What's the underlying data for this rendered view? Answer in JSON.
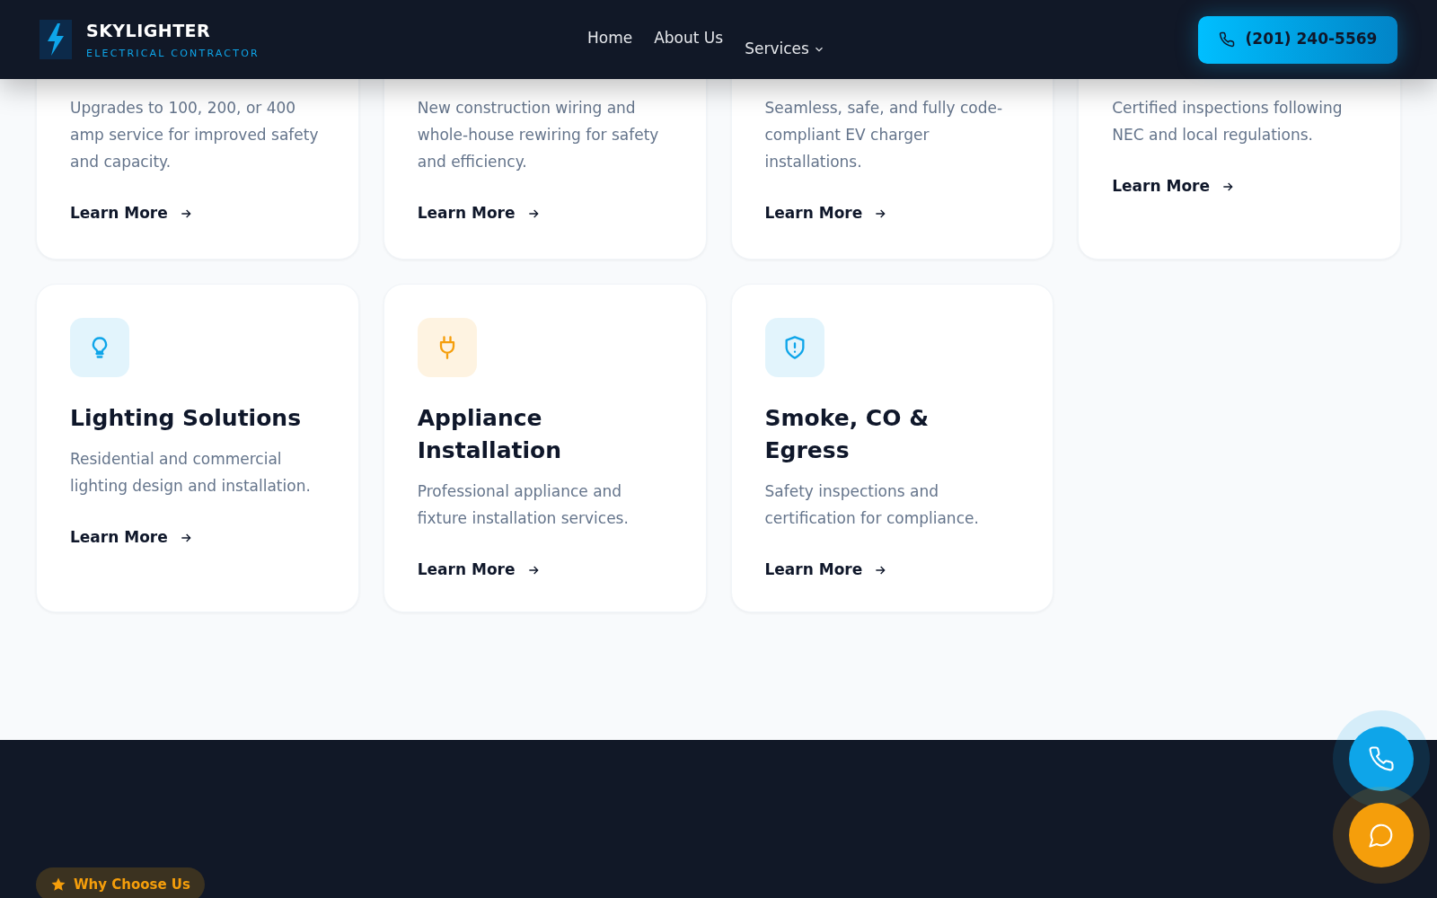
{
  "header": {
    "brand": "SKYLIGHTER",
    "tagline": "ELECTRICAL CONTRACTOR",
    "nav": [
      {
        "label": "Home",
        "dropdown": false
      },
      {
        "label": "About Us",
        "dropdown": false
      },
      {
        "label": "Services",
        "dropdown": true
      }
    ],
    "phone": "(201) 240-5569"
  },
  "services_top": [
    {
      "description": "Upgrades to 100, 200, or 400 amp service for improved safety and capacity.",
      "link": "Learn More"
    },
    {
      "description": "New construction wiring and whole-house rewiring for safety and efficiency.",
      "link": "Learn More"
    },
    {
      "description": "Seamless, safe, and fully code-compliant EV charger installations.",
      "link": "Learn More"
    },
    {
      "description": "Certified inspections following NEC and local regulations.",
      "link": "Learn More"
    }
  ],
  "services": [
    {
      "kind": "bulb",
      "color": "#0ea5e9",
      "title": "Lighting Solutions",
      "description": "Residential and commercial lighting design and installation.",
      "link": "Learn More"
    },
    {
      "kind": "plug",
      "color": "#f59e0b",
      "title": "Appliance Installation",
      "description": "Professional appliance and fixture installation services.",
      "link": "Learn More"
    },
    {
      "kind": "shield",
      "color": "#0ea5e9",
      "title": "Smoke, CO & Egress",
      "description": "Safety inspections and certification for compliance.",
      "link": "Learn More"
    }
  ],
  "why_badge": "Why Choose Us"
}
